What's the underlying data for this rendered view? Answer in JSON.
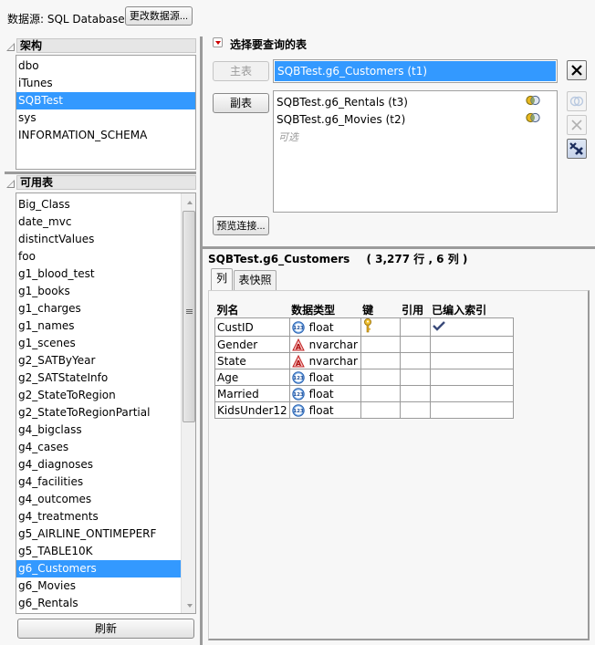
{
  "datasource": {
    "label": "数据源: SQL Databases",
    "change_button": "更改数据源..."
  },
  "schema_panel": {
    "title": "架构",
    "items": [
      "dbo",
      "iTunes",
      "SQBTest",
      "sys",
      "INFORMATION_SCHEMA"
    ],
    "selected": "SQBTest"
  },
  "tables_panel": {
    "title": "可用表",
    "items": [
      "Big_Class",
      "date_mvc",
      "distinctValues",
      "foo",
      "g1_blood_test",
      "g1_books",
      "g1_charges",
      "g1_names",
      "g1_scenes",
      "g2_SATByYear",
      "g2_SATStateInfo",
      "g2_StateToRegion",
      "g2_StateToRegionPartial",
      "g4_bigclass",
      "g4_cases",
      "g4_diagnoses",
      "g4_facilities",
      "g4_outcomes",
      "g4_treatments",
      "g5_AIRLINE_ONTIMEPERF",
      "g5_TABLE10K",
      "g6_Customers",
      "g6_Movies",
      "g6_Rentals"
    ],
    "selected": "g6_Customers",
    "refresh_button": "刷新"
  },
  "query_panel": {
    "title": "选择要查询的表",
    "primary_button": "主表",
    "primary_value": "SQBTest.g6_Customers (t1)",
    "secondary_button": "副表",
    "secondary_items": [
      {
        "name": "SQBTest.g6_Rentals (t3)",
        "icon": "join-icon"
      },
      {
        "name": "SQBTest.g6_Movies (t2)",
        "icon": "join-icon"
      }
    ],
    "optional_hint": "可选",
    "preview_button": "预览连接..."
  },
  "details": {
    "table_name": "SQBTest.g6_Customers",
    "summary": "( 3,277 行 , 6 列 )",
    "tabs": [
      "列",
      "表快照"
    ],
    "active_tab": "列",
    "columns_header": [
      "列名",
      "数据类型",
      "键",
      "引用",
      "已编入索引"
    ],
    "columns": [
      {
        "name": "CustID",
        "type": "float",
        "type_icon": "numeric",
        "key": true,
        "ref": "",
        "indexed": true
      },
      {
        "name": "Gender",
        "type": "nvarchar",
        "type_icon": "character",
        "key": false,
        "ref": "",
        "indexed": false
      },
      {
        "name": "State",
        "type": "nvarchar",
        "type_icon": "character",
        "key": false,
        "ref": "",
        "indexed": false
      },
      {
        "name": "Age",
        "type": "float",
        "type_icon": "numeric",
        "key": false,
        "ref": "",
        "indexed": false
      },
      {
        "name": "Married",
        "type": "float",
        "type_icon": "numeric",
        "key": false,
        "ref": "",
        "indexed": false
      },
      {
        "name": "KidsUnder12",
        "type": "float",
        "type_icon": "numeric",
        "key": false,
        "ref": "",
        "indexed": false
      }
    ]
  },
  "colors": {
    "selection": "#3399ff",
    "disclosure_red": "#cc0000"
  }
}
